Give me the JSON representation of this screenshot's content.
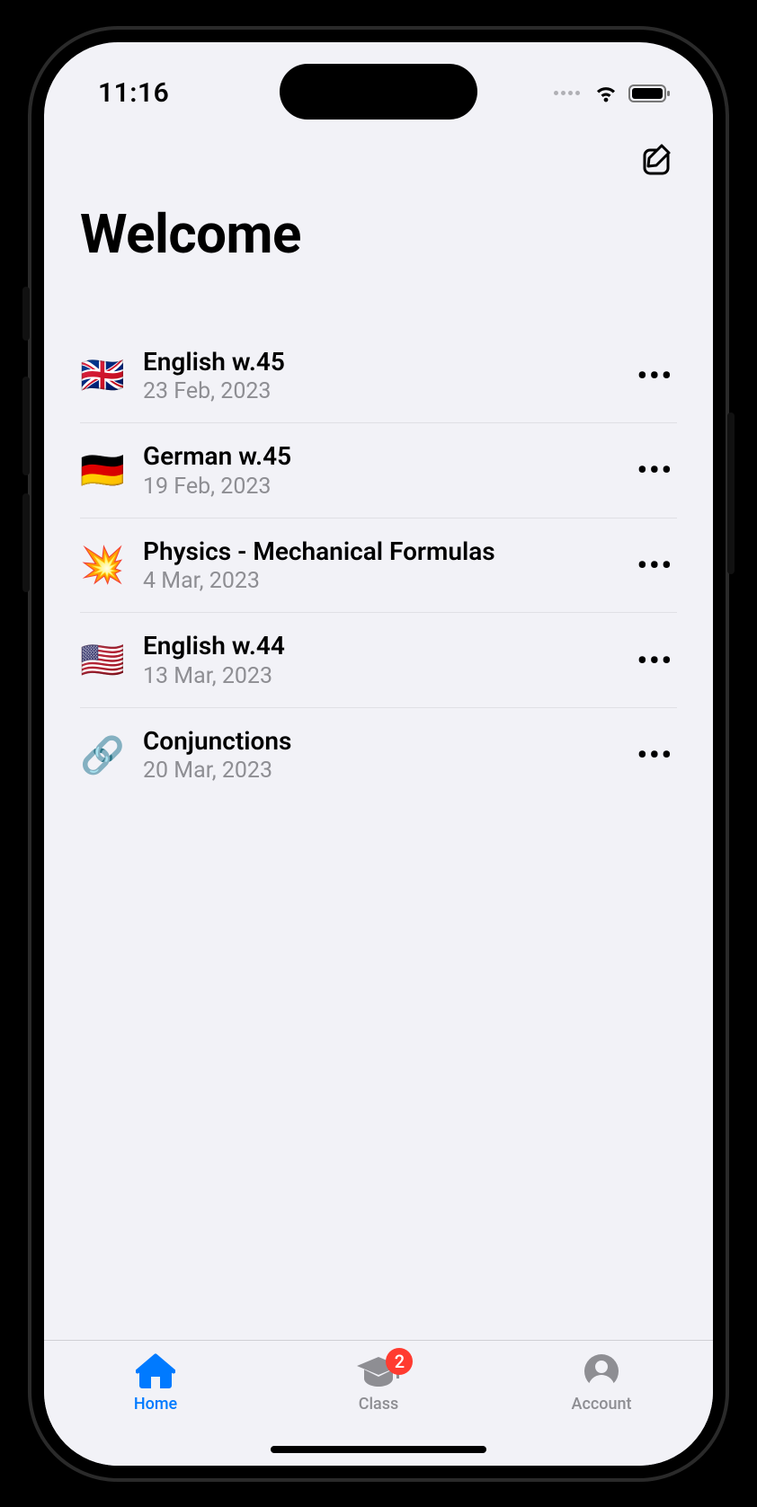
{
  "status": {
    "time": "11:16"
  },
  "header": {
    "title": "Welcome"
  },
  "items": [
    {
      "emoji": "🇬🇧",
      "title": "English w.45",
      "date": "23 Feb, 2023"
    },
    {
      "emoji": "🇩🇪",
      "title": "German w.45",
      "date": "19 Feb, 2023"
    },
    {
      "emoji": "💥",
      "title": "Physics - Mechanical Formulas",
      "date": "4 Mar, 2023"
    },
    {
      "emoji": "🇺🇸",
      "title": "English w.44",
      "date": "13 Mar, 2023"
    },
    {
      "emoji": "🔗",
      "title": "Conjunctions",
      "date": "20 Mar, 2023"
    }
  ],
  "tabs": {
    "home": "Home",
    "class": "Class",
    "class_badge": "2",
    "account": "Account"
  },
  "colors": {
    "accent": "#007aff",
    "badge": "#ff3b30",
    "inactive": "#8e8e93",
    "bg": "#f2f2f7"
  }
}
